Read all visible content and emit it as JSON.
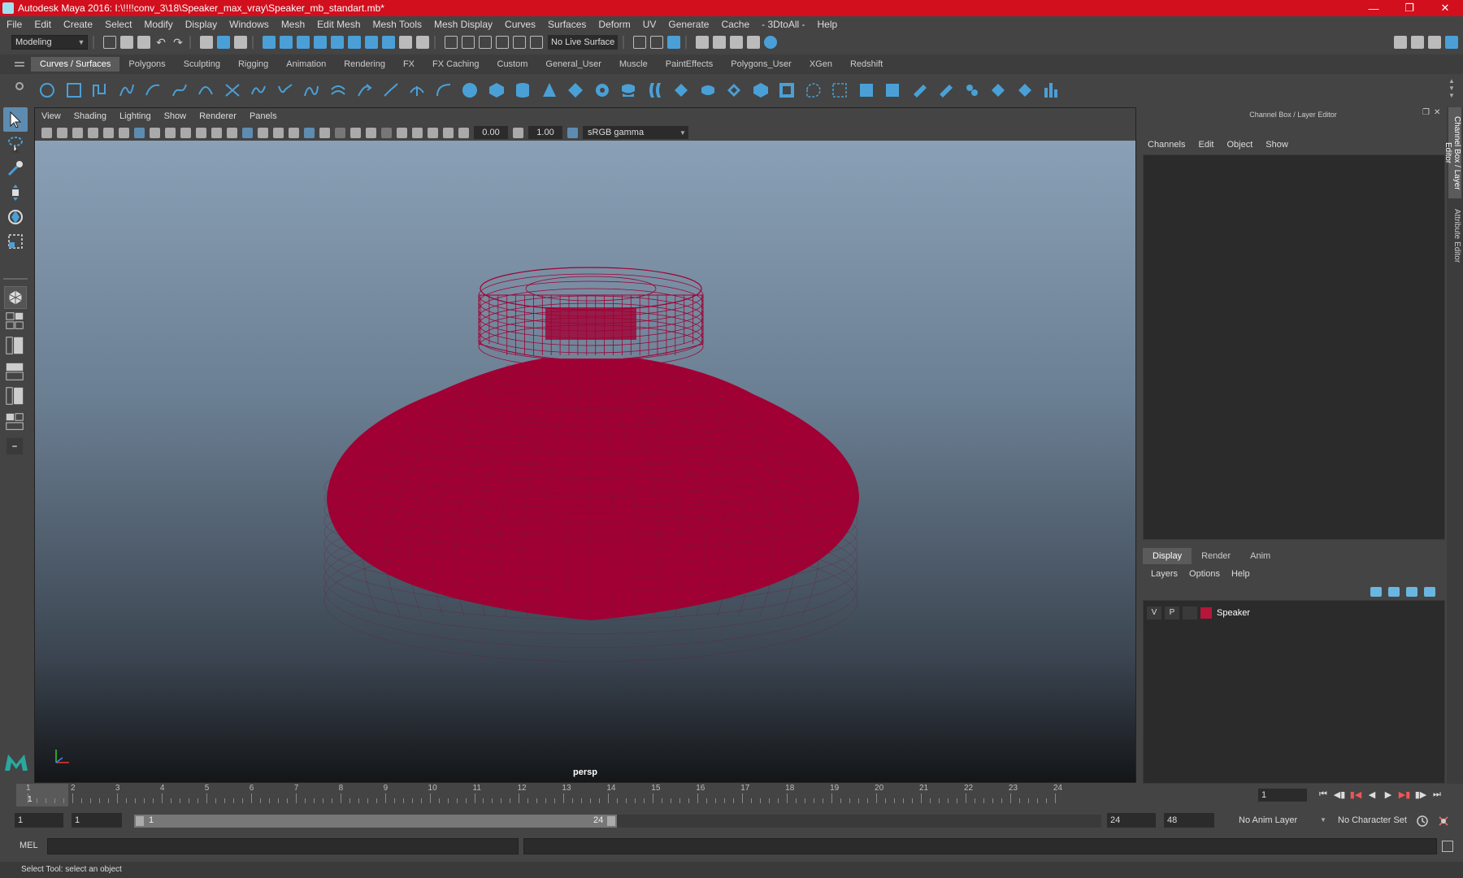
{
  "window": {
    "title": "Autodesk Maya 2016: I:\\!!!!conv_3\\18\\Speaker_max_vray\\Speaker_mb_standart.mb*",
    "controls": [
      "minimize",
      "restore",
      "close"
    ]
  },
  "menubar": [
    "File",
    "Edit",
    "Create",
    "Select",
    "Modify",
    "Display",
    "Windows",
    "Mesh",
    "Edit Mesh",
    "Mesh Tools",
    "Mesh Display",
    "Curves",
    "Surfaces",
    "Deform",
    "UV",
    "Generate",
    "Cache",
    "- 3DtoAll -",
    "Help"
  ],
  "statusline": {
    "mode": "Modeling",
    "live_surface": "No Live Surface"
  },
  "shelf": {
    "tabs": [
      "Curves / Surfaces",
      "Polygons",
      "Sculpting",
      "Rigging",
      "Animation",
      "Rendering",
      "FX",
      "FX Caching",
      "Custom",
      "General_User",
      "Muscle",
      "PaintEffects",
      "Polygons_User",
      "XGen",
      "Redshift"
    ],
    "active_tab": "Curves / Surfaces"
  },
  "viewport": {
    "panel_menu": [
      "View",
      "Shading",
      "Lighting",
      "Show",
      "Renderer",
      "Panels"
    ],
    "exposure": "0.00",
    "gamma_value": "1.00",
    "color_space": "sRGB gamma",
    "camera": "persp",
    "model_color": "#a00033",
    "model_label": "Speaker"
  },
  "channel_box": {
    "title": "Channel Box / Layer Editor",
    "menu": [
      "Channels",
      "Edit",
      "Object",
      "Show"
    ],
    "layer_tabs": [
      "Display",
      "Render",
      "Anim"
    ],
    "active_layer_tab": "Display",
    "layer_menu": [
      "Layers",
      "Options",
      "Help"
    ],
    "layers": [
      {
        "v": "V",
        "p": "P",
        "color": "#b5163a",
        "name": "Speaker"
      }
    ]
  },
  "side_tabs": [
    "Channel Box / Layer Editor",
    "Attribute Editor"
  ],
  "timeline": {
    "ticks": [
      "1",
      "2",
      "3",
      "4",
      "5",
      "6",
      "7",
      "8",
      "9",
      "10",
      "11",
      "12",
      "13",
      "14",
      "15",
      "16",
      "17",
      "18",
      "19",
      "20",
      "21",
      "22",
      "23",
      "24"
    ],
    "current_frame_marker": "1",
    "current_frame_field": "1"
  },
  "range": {
    "start_field": "1",
    "playback_start": "1",
    "range_start_label": "1",
    "range_end_label": "24",
    "playback_end": "24",
    "end_field": "48",
    "anim_layer": "No Anim Layer",
    "character_set": "No Character Set"
  },
  "command_line": {
    "label": "MEL"
  },
  "help_line": {
    "text": "Select Tool: select an object"
  }
}
